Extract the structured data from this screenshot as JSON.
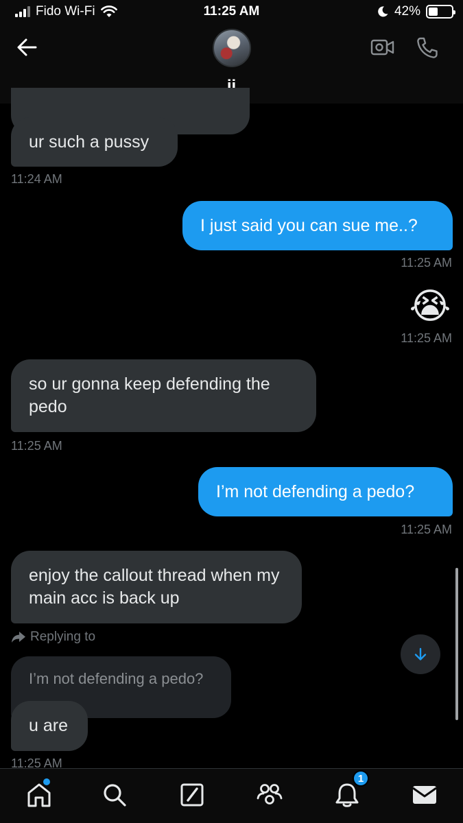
{
  "status_bar": {
    "carrier": "Fido Wi-Fi",
    "time": "11:25 AM",
    "battery_percent": "42%",
    "battery_level": 0.42
  },
  "header": {
    "contact_name": "jj"
  },
  "messages": [
    {
      "direction": "incoming",
      "text": "ur such a pussy",
      "time": "11:24 AM"
    },
    {
      "direction": "outgoing",
      "text": "I just said you can sue me..?",
      "time": "11:25 AM"
    },
    {
      "direction": "outgoing",
      "text": "😭",
      "time": "11:25 AM"
    },
    {
      "direction": "incoming",
      "text": "so ur gonna keep defending the pedo",
      "time": "11:25 AM"
    },
    {
      "direction": "outgoing",
      "text": "I’m not defending a pedo?",
      "time": "11:25 AM"
    },
    {
      "direction": "incoming",
      "text": "enjoy the callout thread when my main acc is back up"
    },
    {
      "direction": "incoming",
      "reply_label": "Replying to",
      "quoted_text": "I’m not defending a pedo?",
      "text": "u are",
      "time": "11:25 AM"
    }
  ],
  "tab_bar": {
    "notifications_badge": "1"
  },
  "icons": {
    "back": "back-arrow-icon",
    "video": "video-call-icon",
    "call": "phone-icon",
    "scroll": "arrow-down-icon",
    "tabs": [
      "home-icon",
      "search-icon",
      "compose-icon",
      "communities-icon",
      "bell-icon",
      "mail-icon"
    ]
  },
  "colors": {
    "accent": "#1d9bf0",
    "incoming_bubble": "#2f3336",
    "background": "#000000"
  }
}
